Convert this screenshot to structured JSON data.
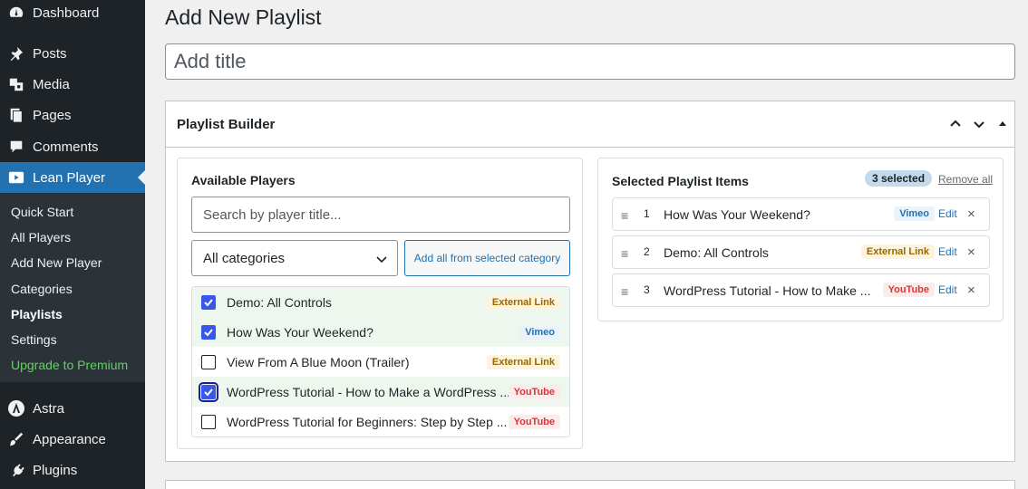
{
  "sidebar": {
    "top_items": [
      {
        "label": "Dashboard",
        "icon": "dashboard-icon"
      },
      {
        "label": "Posts",
        "icon": "pin-icon"
      },
      {
        "label": "Media",
        "icon": "media-icon"
      },
      {
        "label": "Pages",
        "icon": "pages-icon"
      },
      {
        "label": "Comments",
        "icon": "comments-icon"
      },
      {
        "label": "Lean Player",
        "icon": "video-icon"
      }
    ],
    "submenu": [
      "Quick Start",
      "All Players",
      "Add New Player",
      "Categories",
      "Playlists",
      "Settings",
      "Upgrade to Premium"
    ],
    "bottom_items": [
      {
        "label": "Astra",
        "icon": "astra-icon"
      },
      {
        "label": "Appearance",
        "icon": "brush-icon"
      },
      {
        "label": "Plugins",
        "icon": "plugin-icon"
      }
    ]
  },
  "page": {
    "title": "Add New Playlist",
    "title_placeholder": "Add title"
  },
  "builder": {
    "title": "Playlist Builder",
    "available": {
      "title": "Available Players",
      "search_placeholder": "Search by player title...",
      "category_selected": "All categories",
      "add_all_label": "Add all from selected category",
      "players": [
        {
          "name": "Demo: All Controls",
          "type": "External Link",
          "checked": true
        },
        {
          "name": "How Was Your Weekend?",
          "type": "Vimeo",
          "checked": true
        },
        {
          "name": "View From A Blue Moon (Trailer)",
          "type": "External Link",
          "checked": false
        },
        {
          "name": "WordPress Tutorial - How to Make a WordPress ...",
          "type": "YouTube",
          "checked": true
        },
        {
          "name": "WordPress Tutorial for Beginners: Step by Step ...",
          "type": "YouTube",
          "checked": false
        }
      ]
    },
    "selected": {
      "title": "Selected Playlist Items",
      "count_label": "3 selected",
      "remove_all_label": "Remove all",
      "edit_label": "Edit",
      "remove_symbol": "×",
      "handle_symbol": "≡",
      "items": [
        {
          "num": "1",
          "title": "How Was Your Weekend?",
          "type": "Vimeo"
        },
        {
          "num": "2",
          "title": "Demo: All Controls",
          "type": "External Link"
        },
        {
          "num": "3",
          "title": "WordPress Tutorial - How to Make ...",
          "type": "YouTube"
        }
      ]
    }
  },
  "colors": {
    "sidebar_bg": "#1d2327",
    "submenu_bg": "#2c3338",
    "accent": "#2271b1",
    "checkbox": "#3858e9",
    "premium": "#5fd35f",
    "youtube": "#d63638",
    "external": "#9a6700"
  }
}
